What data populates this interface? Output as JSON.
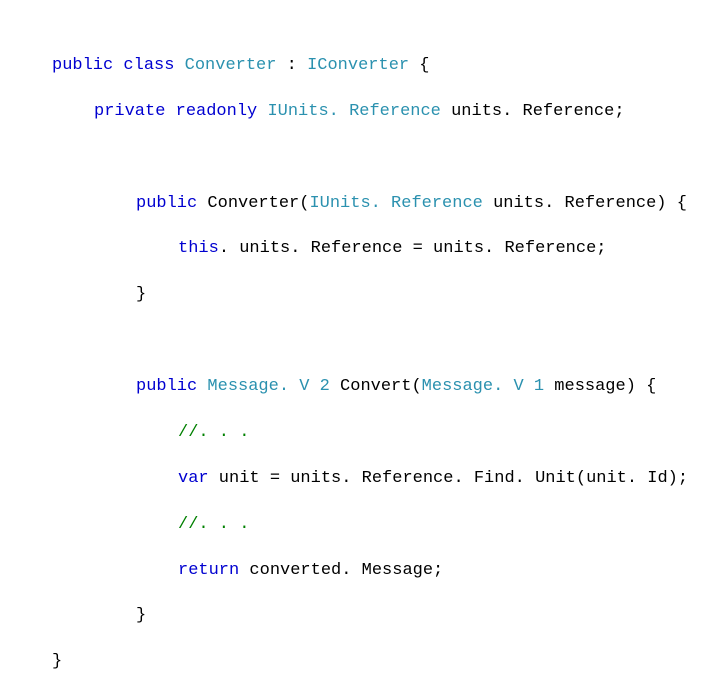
{
  "t": {
    "l1_public": "public",
    "l1_class": "class",
    "l1_conv": "Converter",
    "l1_colon": " : ",
    "l1_iconv": "IConverter",
    "l1_brace": " {",
    "l2_private": "private",
    "l2_readonly": "readonly",
    "l2_type": "IUnits. Reference",
    "l2_rest": " units. Reference;",
    "l3_public": "public",
    "l3_a": " Converter(",
    "l3_type": "IUnits. Reference",
    "l3_b": " units. Reference) {",
    "l4": "this. units. Reference = units. Reference;",
    "l5": "}",
    "l6_public": "public",
    "l6_sp": " ",
    "l6_t1": "Message. V 2",
    "l6_mid": " Convert(",
    "l6_t2": "Message. V 1",
    "l6_end": " message) {",
    "l7": "//. . .",
    "l8": "var unit = units. Reference. Find. Unit(unit. Id);",
    "l9": "//. . .",
    "l10": "return converted. Message;",
    "l11": "}",
    "l12": "}"
  }
}
